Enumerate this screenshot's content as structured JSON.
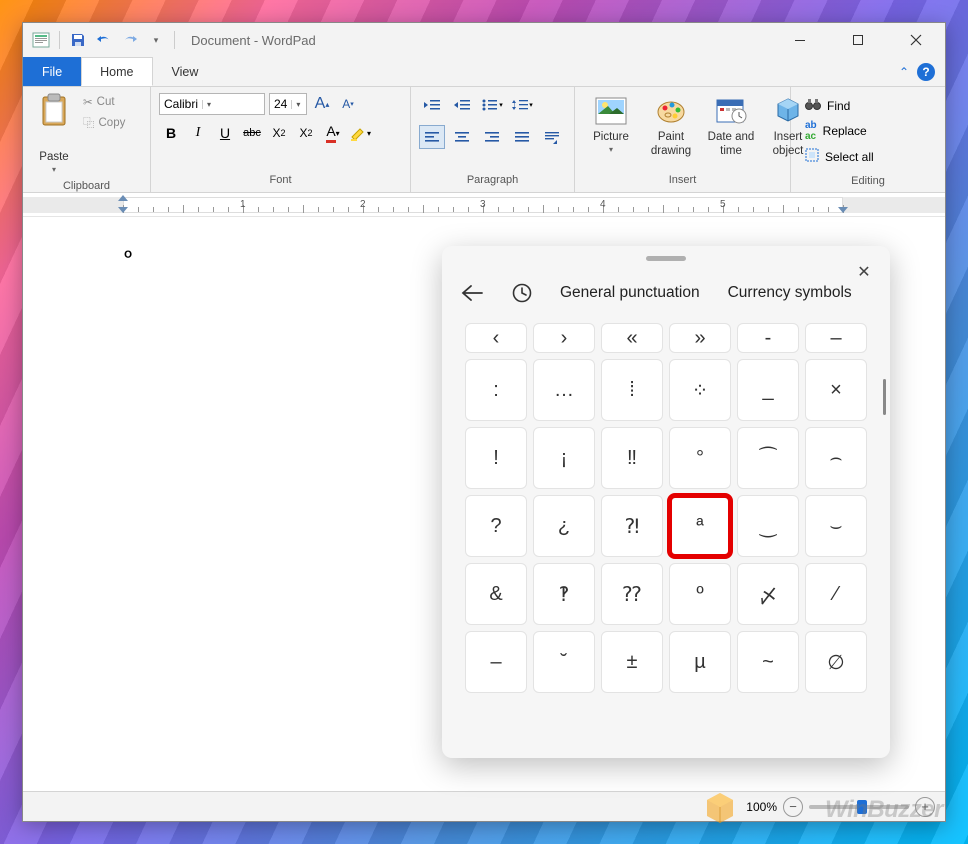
{
  "title": "Document - WordPad",
  "tabs": {
    "file": "File",
    "home": "Home",
    "view": "View"
  },
  "clipboard": {
    "paste": "Paste",
    "cut": "Cut",
    "copy": "Copy",
    "label": "Clipboard"
  },
  "font": {
    "name": "Calibri",
    "size": "24",
    "label": "Font"
  },
  "paragraph": {
    "label": "Paragraph"
  },
  "insert": {
    "picture": "Picture",
    "paint": "Paint\ndrawing",
    "datetime": "Date and\ntime",
    "object": "Insert\nobject",
    "label": "Insert"
  },
  "editing": {
    "find": "Find",
    "replace": "Replace",
    "selectall": "Select all",
    "label": "Editing"
  },
  "ruler_numbers": [
    "1",
    "2",
    "3",
    "4",
    "5"
  ],
  "document_text": "º",
  "status": {
    "zoom": "100%"
  },
  "picker": {
    "categories": [
      "General punctuation",
      "Currency symbols"
    ],
    "active_category": 0,
    "highlighted_index": 21,
    "symbols": [
      "‹",
      "›",
      "«",
      "»",
      "‐",
      "–",
      ":",
      "…",
      "⁞",
      "⁘",
      "_",
      "×",
      "!",
      "¡",
      "‼",
      "°",
      "⁀",
      "⌢",
      "?",
      "¿",
      "⁈",
      "ª",
      "‿",
      "⌣",
      "&",
      "‽",
      "⁇",
      "º",
      "〆",
      "⁄",
      "‒",
      "˘",
      "±",
      "µ",
      "~",
      "∅"
    ]
  },
  "watermark": "WinBuzzer"
}
